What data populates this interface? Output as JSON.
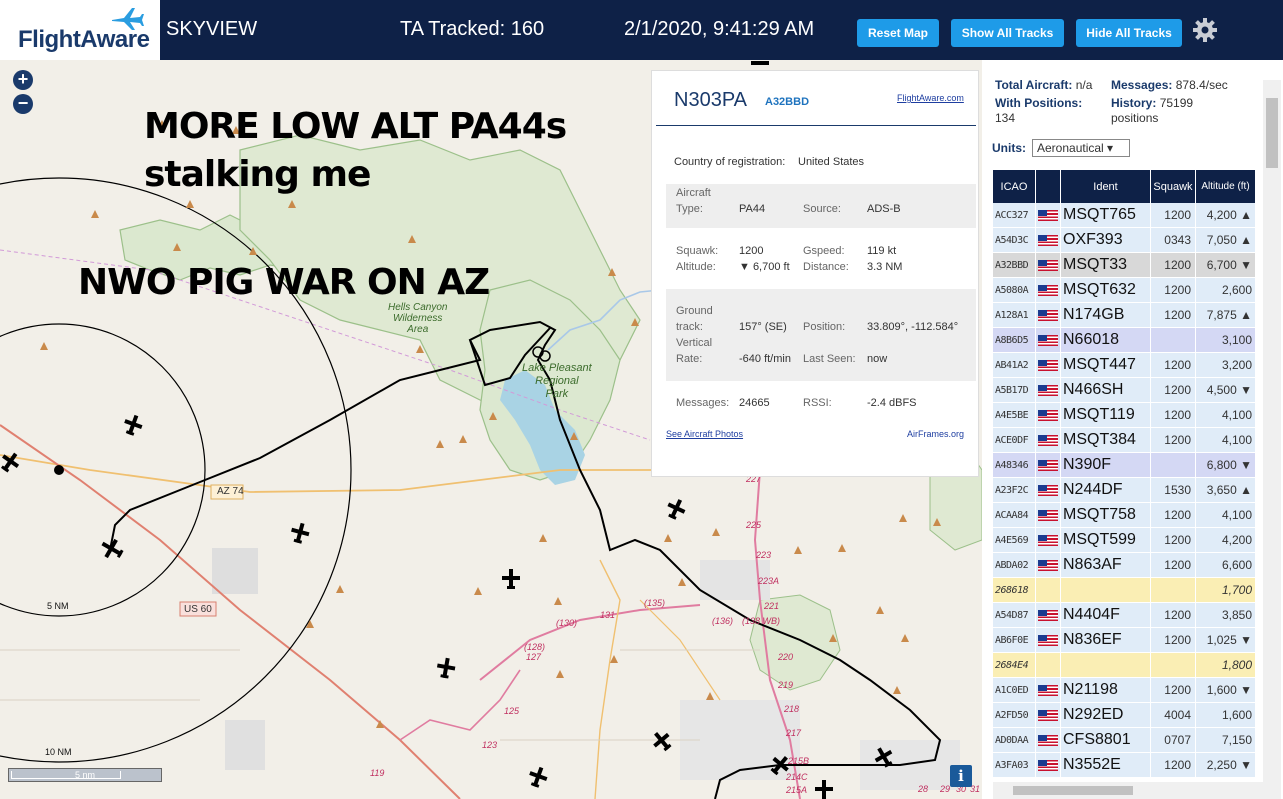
{
  "header": {
    "logo_text": "FlightAware",
    "app_name": "SKYVIEW",
    "tracked": "TA Tracked: 160",
    "datetime": "2/1/2020, 9:41:29 AM",
    "buttons": [
      "Reset Map",
      "Show All Tracks",
      "Hide All Tracks"
    ]
  },
  "map": {
    "overlay_lines": [
      "MORE LOW ALT PA44s",
      "stalking me",
      "NWO PIG WAR ON AZ"
    ],
    "park_labels": {
      "hells_canyon": [
        "Hells Canyon",
        "Wilderness",
        "Area"
      ],
      "lake_pleasant": [
        "Lake Pleasant",
        "Regional",
        "Park"
      ]
    },
    "route_labels": [
      "AZ 74",
      "US 60"
    ],
    "ring_labels": [
      "5 NM",
      "10 NM"
    ],
    "scale_label": "5 nm",
    "road_numbers": [
      "227",
      "225",
      "223",
      "223A",
      "221",
      "(136)",
      "(138 WB)",
      "(135)",
      "131",
      "(130)",
      "(128)",
      "127",
      "125",
      "123",
      "119",
      "220",
      "219",
      "218",
      "217",
      "215B",
      "214C",
      "215A",
      "28",
      "29",
      "30",
      "31"
    ],
    "info_button": "i"
  },
  "aircraft_panel": {
    "registration": "N303PA",
    "hex": "A32BBD",
    "flightaware_link": "FlightAware.com",
    "country_label": "Country of registration:",
    "country": "United States",
    "aircraft_type_label": [
      "Aircraft",
      "Type:"
    ],
    "aircraft_type": "PA44",
    "source_label": "Source:",
    "source": "ADS-B",
    "squawk_label": "Squawk:",
    "squawk": "1200",
    "altitude_label": "Altitude:",
    "altitude": "▼ 6,700 ft",
    "gspeed_label": "Gspeed:",
    "gspeed": "119 kt",
    "distance_label": "Distance:",
    "distance": "3.3 NM",
    "ground_track_label": [
      "Ground",
      "track:"
    ],
    "ground_track": "157° (SE)",
    "position_label": "Position:",
    "position": "33.809°, -112.584°",
    "vertical_rate_label": [
      "Vertical",
      "Rate:"
    ],
    "vertical_rate": "-640 ft/min",
    "last_seen_label": "Last Seen:",
    "last_seen": "now",
    "messages_label": "Messages:",
    "messages": "24665",
    "rssi_label": "RSSI:",
    "rssi": "-2.4 dBFS",
    "photos_link": "See Aircraft Photos",
    "airframes_link": "AirFrames.org"
  },
  "stats": {
    "total_label": "Total Aircraft:",
    "total": "n/a",
    "messages_label": "Messages:",
    "messages": "878.4/sec",
    "positions_label": "With Positions:",
    "positions": "134",
    "history_label": "History:",
    "history": "75199",
    "history_unit": "positions",
    "units_label": "Units:",
    "units_value": "Aeronautical ▾"
  },
  "table": {
    "headers": [
      "ICAO",
      "",
      "Ident",
      "Squawk",
      "Altitude (ft)"
    ],
    "rows": [
      {
        "icao": "ACC327",
        "ident": "MSQT765",
        "squawk": "1200",
        "alt": "4,200 ▲",
        "bg": "#e0ecf8"
      },
      {
        "icao": "A54D3C",
        "ident": "OXF393",
        "squawk": "0343",
        "alt": "7,050 ▲",
        "bg": "#e0ecf8"
      },
      {
        "icao": "A32BBD",
        "ident": "MSQT33",
        "squawk": "1200",
        "alt": "6,700 ▼",
        "bg": "#d8d8d8"
      },
      {
        "icao": "A5080A",
        "ident": "MSQT632",
        "squawk": "1200",
        "alt": "2,600",
        "bg": "#e0ecf8"
      },
      {
        "icao": "A128A1",
        "ident": "N174GB",
        "squawk": "1200",
        "alt": "7,875 ▲",
        "bg": "#e0ecf8"
      },
      {
        "icao": "A8B6D5",
        "ident": "N66018",
        "squawk": "",
        "alt": "3,100",
        "bg": "#d4d8f4"
      },
      {
        "icao": "AB41A2",
        "ident": "MSQT447",
        "squawk": "1200",
        "alt": "3,200",
        "bg": "#e0ecf8"
      },
      {
        "icao": "A5B17D",
        "ident": "N466SH",
        "squawk": "1200",
        "alt": "4,500 ▼",
        "bg": "#e0ecf8"
      },
      {
        "icao": "A4E5BE",
        "ident": "MSQT119",
        "squawk": "1200",
        "alt": "4,100",
        "bg": "#e0ecf8"
      },
      {
        "icao": "ACE0DF",
        "ident": "MSQT384",
        "squawk": "1200",
        "alt": "4,100",
        "bg": "#e0ecf8"
      },
      {
        "icao": "A48346",
        "ident": "N390F",
        "squawk": "",
        "alt": "6,800 ▼",
        "bg": "#d4d8f4"
      },
      {
        "icao": "A23F2C",
        "ident": "N244DF",
        "squawk": "1530",
        "alt": "3,650 ▲",
        "bg": "#e0ecf8"
      },
      {
        "icao": "ACAA84",
        "ident": "MSQT758",
        "squawk": "1200",
        "alt": "4,100",
        "bg": "#e0ecf8"
      },
      {
        "icao": "A4E569",
        "ident": "MSQT599",
        "squawk": "1200",
        "alt": "4,200",
        "bg": "#e0ecf8"
      },
      {
        "icao": "ABDA02",
        "ident": "N863AF",
        "squawk": "1200",
        "alt": "6,600",
        "bg": "#e0ecf8"
      },
      {
        "icao": "268618",
        "ident": "",
        "squawk": "",
        "alt": "1,700",
        "bg": "#faeeb4",
        "italic": true
      },
      {
        "icao": "A54D87",
        "ident": "N4404F",
        "squawk": "1200",
        "alt": "3,850",
        "bg": "#e0ecf8"
      },
      {
        "icao": "AB6F0E",
        "ident": "N836EF",
        "squawk": "1200",
        "alt": "1,025 ▼",
        "bg": "#e0ecf8"
      },
      {
        "icao": "2684E4",
        "ident": "",
        "squawk": "",
        "alt": "1,800",
        "bg": "#faeeb4",
        "italic": true
      },
      {
        "icao": "A1C0ED",
        "ident": "N21198",
        "squawk": "1200",
        "alt": "1,600 ▼",
        "bg": "#e0ecf8"
      },
      {
        "icao": "A2FD50",
        "ident": "N292ED",
        "squawk": "4004",
        "alt": "1,600",
        "bg": "#e0ecf8"
      },
      {
        "icao": "AD0DAA",
        "ident": "CFS8801",
        "squawk": "0707",
        "alt": "7,150",
        "bg": "#e0ecf8"
      },
      {
        "icao": "A3FA03",
        "ident": "N3552E",
        "squawk": "1200",
        "alt": "2,250 ▼",
        "bg": "#e0ecf8"
      }
    ]
  }
}
